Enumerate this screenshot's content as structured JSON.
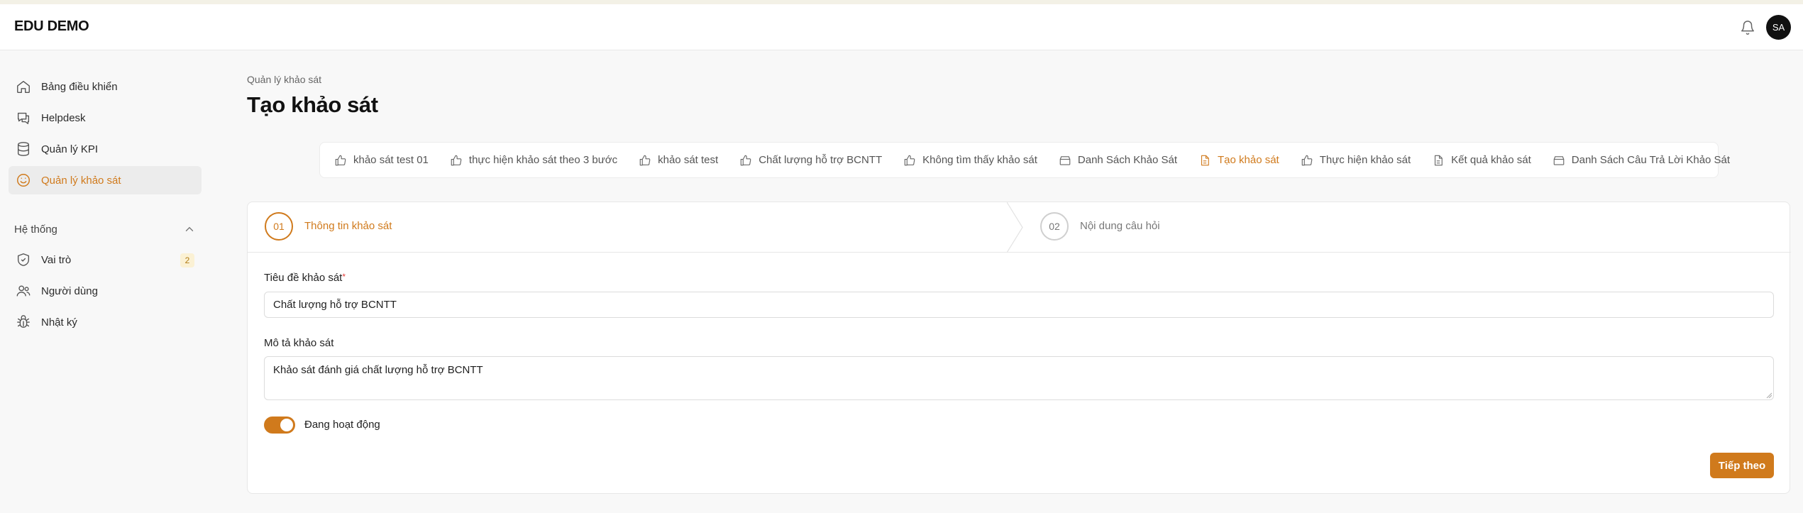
{
  "app": {
    "brand": "EDU DEMO",
    "avatar_initials": "SA",
    "accent_color": "#d07a1c"
  },
  "sidebar": {
    "items": [
      {
        "label": "Bảng điều khiển",
        "icon": "home-icon"
      },
      {
        "label": "Helpdesk",
        "icon": "chat-icon"
      },
      {
        "label": "Quản lý KPI",
        "icon": "database-icon"
      },
      {
        "label": "Quản lý khảo sát",
        "icon": "smile-icon",
        "active": true
      }
    ],
    "group": {
      "title": "Hệ thống",
      "items": [
        {
          "label": "Vai trò",
          "icon": "shield-icon",
          "badge": "2"
        },
        {
          "label": "Người dùng",
          "icon": "users-icon"
        },
        {
          "label": "Nhật ký",
          "icon": "bug-icon"
        }
      ]
    }
  },
  "page": {
    "breadcrumb": "Quản lý khảo sát",
    "title": "Tạo khảo sát"
  },
  "tabs": [
    {
      "label": "khảo sát test 01",
      "icon": "thumbs-up-icon"
    },
    {
      "label": "thực hiện khảo sát theo 3 bước",
      "icon": "thumbs-up-icon"
    },
    {
      "label": "khảo sát test",
      "icon": "thumbs-up-icon"
    },
    {
      "label": "Chất lượng hỗ trợ BCNTT",
      "icon": "thumbs-up-icon"
    },
    {
      "label": "Không tìm thấy khảo sát",
      "icon": "thumbs-up-icon"
    },
    {
      "label": "Danh Sách Khảo Sát",
      "icon": "archive-icon"
    },
    {
      "label": "Tạo khảo sát",
      "icon": "document-icon",
      "active": true
    },
    {
      "label": "Thực hiện khảo sát",
      "icon": "thumbs-up-icon"
    },
    {
      "label": "Kết quả khảo sát",
      "icon": "document-icon"
    },
    {
      "label": "Danh Sách Câu Trả Lời Khảo Sát",
      "icon": "archive-icon"
    }
  ],
  "steps": [
    {
      "number": "01",
      "label": "Thông tin khảo sát",
      "active": true
    },
    {
      "number": "02",
      "label": "Nội dung câu hỏi",
      "active": false
    }
  ],
  "form": {
    "title_label": "Tiêu đề khảo sát",
    "required_mark": "*",
    "title_value": "Chất lượng hỗ trợ BCNTT",
    "description_label": "Mô tả khảo sát",
    "description_value": "Khảo sát đánh giá chất lượng hỗ trợ BCNTT",
    "active_toggle_label": "Đang hoạt động",
    "active_toggle_on": true,
    "next_button": "Tiếp theo"
  }
}
